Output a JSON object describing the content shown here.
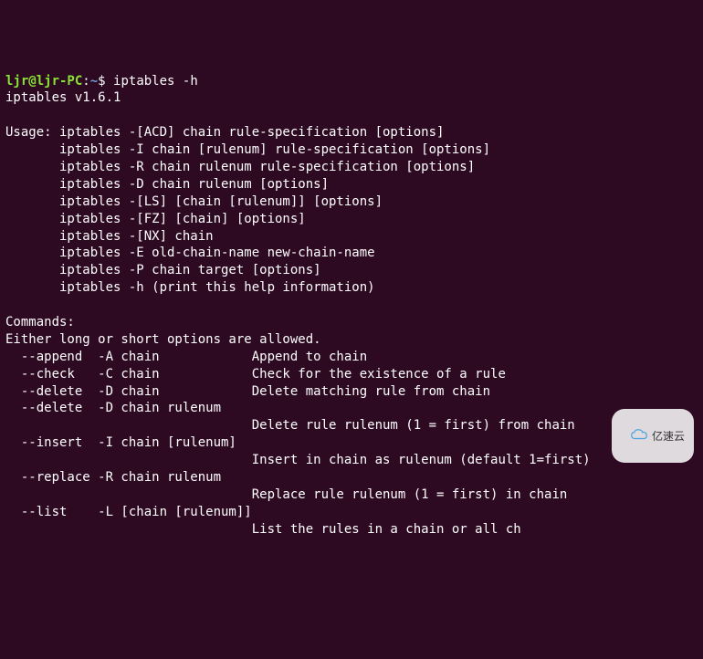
{
  "prompt": {
    "user_host": "ljr@ljr-PC",
    "separator": ":",
    "path": "~",
    "symbol": "$ ",
    "command": "iptables -h"
  },
  "lines": {
    "l0": "iptables v1.6.1",
    "l1": "",
    "l2": "Usage: iptables -[ACD] chain rule-specification [options]",
    "l3": "       iptables -I chain [rulenum] rule-specification [options]",
    "l4": "       iptables -R chain rulenum rule-specification [options]",
    "l5": "       iptables -D chain rulenum [options]",
    "l6": "       iptables -[LS] [chain [rulenum]] [options]",
    "l7": "       iptables -[FZ] [chain] [options]",
    "l8": "       iptables -[NX] chain",
    "l9": "       iptables -E old-chain-name new-chain-name",
    "l10": "       iptables -P chain target [options]",
    "l11": "       iptables -h (print this help information)",
    "l12": "",
    "l13": "Commands:",
    "l14": "Either long or short options are allowed.",
    "l15": "  --append  -A chain            Append to chain",
    "l16": "  --check   -C chain            Check for the existence of a rule",
    "l17": "  --delete  -D chain            Delete matching rule from chain",
    "l18": "  --delete  -D chain rulenum",
    "l19": "                                Delete rule rulenum (1 = first) from chain",
    "l20": "  --insert  -I chain [rulenum]",
    "l21": "                                Insert in chain as rulenum (default 1=first)",
    "l22": "  --replace -R chain rulenum",
    "l23": "                                Replace rule rulenum (1 = first) in chain",
    "l24": "  --list    -L [chain [rulenum]]",
    "l25": "                                List the rules in a chain or all ch"
  },
  "watermark": {
    "text": "亿速云"
  }
}
